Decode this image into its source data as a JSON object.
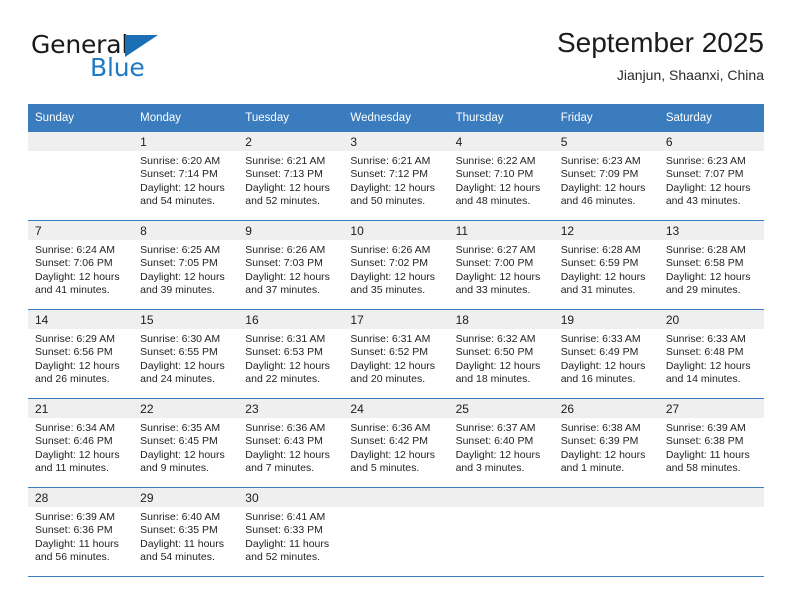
{
  "brand": {
    "name_top": "General",
    "name_bottom": "Blue",
    "accent_color": "#1a6fb5"
  },
  "header": {
    "title": "September 2025",
    "subtitle": "Jianjun, Shaanxi, China"
  },
  "calendar": {
    "header_bg": "#3a7cbe",
    "daynum_bg": "#efefef",
    "weekday_headers": [
      "Sunday",
      "Monday",
      "Tuesday",
      "Wednesday",
      "Thursday",
      "Friday",
      "Saturday"
    ],
    "weeks": [
      [
        {
          "day": "",
          "sunrise": "",
          "sunset": "",
          "daylight_line1": "",
          "daylight_line2": ""
        },
        {
          "day": "1",
          "sunrise": "Sunrise: 6:20 AM",
          "sunset": "Sunset: 7:14 PM",
          "daylight_line1": "Daylight: 12 hours",
          "daylight_line2": "and 54 minutes."
        },
        {
          "day": "2",
          "sunrise": "Sunrise: 6:21 AM",
          "sunset": "Sunset: 7:13 PM",
          "daylight_line1": "Daylight: 12 hours",
          "daylight_line2": "and 52 minutes."
        },
        {
          "day": "3",
          "sunrise": "Sunrise: 6:21 AM",
          "sunset": "Sunset: 7:12 PM",
          "daylight_line1": "Daylight: 12 hours",
          "daylight_line2": "and 50 minutes."
        },
        {
          "day": "4",
          "sunrise": "Sunrise: 6:22 AM",
          "sunset": "Sunset: 7:10 PM",
          "daylight_line1": "Daylight: 12 hours",
          "daylight_line2": "and 48 minutes."
        },
        {
          "day": "5",
          "sunrise": "Sunrise: 6:23 AM",
          "sunset": "Sunset: 7:09 PM",
          "daylight_line1": "Daylight: 12 hours",
          "daylight_line2": "and 46 minutes."
        },
        {
          "day": "6",
          "sunrise": "Sunrise: 6:23 AM",
          "sunset": "Sunset: 7:07 PM",
          "daylight_line1": "Daylight: 12 hours",
          "daylight_line2": "and 43 minutes."
        }
      ],
      [
        {
          "day": "7",
          "sunrise": "Sunrise: 6:24 AM",
          "sunset": "Sunset: 7:06 PM",
          "daylight_line1": "Daylight: 12 hours",
          "daylight_line2": "and 41 minutes."
        },
        {
          "day": "8",
          "sunrise": "Sunrise: 6:25 AM",
          "sunset": "Sunset: 7:05 PM",
          "daylight_line1": "Daylight: 12 hours",
          "daylight_line2": "and 39 minutes."
        },
        {
          "day": "9",
          "sunrise": "Sunrise: 6:26 AM",
          "sunset": "Sunset: 7:03 PM",
          "daylight_line1": "Daylight: 12 hours",
          "daylight_line2": "and 37 minutes."
        },
        {
          "day": "10",
          "sunrise": "Sunrise: 6:26 AM",
          "sunset": "Sunset: 7:02 PM",
          "daylight_line1": "Daylight: 12 hours",
          "daylight_line2": "and 35 minutes."
        },
        {
          "day": "11",
          "sunrise": "Sunrise: 6:27 AM",
          "sunset": "Sunset: 7:00 PM",
          "daylight_line1": "Daylight: 12 hours",
          "daylight_line2": "and 33 minutes."
        },
        {
          "day": "12",
          "sunrise": "Sunrise: 6:28 AM",
          "sunset": "Sunset: 6:59 PM",
          "daylight_line1": "Daylight: 12 hours",
          "daylight_line2": "and 31 minutes."
        },
        {
          "day": "13",
          "sunrise": "Sunrise: 6:28 AM",
          "sunset": "Sunset: 6:58 PM",
          "daylight_line1": "Daylight: 12 hours",
          "daylight_line2": "and 29 minutes."
        }
      ],
      [
        {
          "day": "14",
          "sunrise": "Sunrise: 6:29 AM",
          "sunset": "Sunset: 6:56 PM",
          "daylight_line1": "Daylight: 12 hours",
          "daylight_line2": "and 26 minutes."
        },
        {
          "day": "15",
          "sunrise": "Sunrise: 6:30 AM",
          "sunset": "Sunset: 6:55 PM",
          "daylight_line1": "Daylight: 12 hours",
          "daylight_line2": "and 24 minutes."
        },
        {
          "day": "16",
          "sunrise": "Sunrise: 6:31 AM",
          "sunset": "Sunset: 6:53 PM",
          "daylight_line1": "Daylight: 12 hours",
          "daylight_line2": "and 22 minutes."
        },
        {
          "day": "17",
          "sunrise": "Sunrise: 6:31 AM",
          "sunset": "Sunset: 6:52 PM",
          "daylight_line1": "Daylight: 12 hours",
          "daylight_line2": "and 20 minutes."
        },
        {
          "day": "18",
          "sunrise": "Sunrise: 6:32 AM",
          "sunset": "Sunset: 6:50 PM",
          "daylight_line1": "Daylight: 12 hours",
          "daylight_line2": "and 18 minutes."
        },
        {
          "day": "19",
          "sunrise": "Sunrise: 6:33 AM",
          "sunset": "Sunset: 6:49 PM",
          "daylight_line1": "Daylight: 12 hours",
          "daylight_line2": "and 16 minutes."
        },
        {
          "day": "20",
          "sunrise": "Sunrise: 6:33 AM",
          "sunset": "Sunset: 6:48 PM",
          "daylight_line1": "Daylight: 12 hours",
          "daylight_line2": "and 14 minutes."
        }
      ],
      [
        {
          "day": "21",
          "sunrise": "Sunrise: 6:34 AM",
          "sunset": "Sunset: 6:46 PM",
          "daylight_line1": "Daylight: 12 hours",
          "daylight_line2": "and 11 minutes."
        },
        {
          "day": "22",
          "sunrise": "Sunrise: 6:35 AM",
          "sunset": "Sunset: 6:45 PM",
          "daylight_line1": "Daylight: 12 hours",
          "daylight_line2": "and 9 minutes."
        },
        {
          "day": "23",
          "sunrise": "Sunrise: 6:36 AM",
          "sunset": "Sunset: 6:43 PM",
          "daylight_line1": "Daylight: 12 hours",
          "daylight_line2": "and 7 minutes."
        },
        {
          "day": "24",
          "sunrise": "Sunrise: 6:36 AM",
          "sunset": "Sunset: 6:42 PM",
          "daylight_line1": "Daylight: 12 hours",
          "daylight_line2": "and 5 minutes."
        },
        {
          "day": "25",
          "sunrise": "Sunrise: 6:37 AM",
          "sunset": "Sunset: 6:40 PM",
          "daylight_line1": "Daylight: 12 hours",
          "daylight_line2": "and 3 minutes."
        },
        {
          "day": "26",
          "sunrise": "Sunrise: 6:38 AM",
          "sunset": "Sunset: 6:39 PM",
          "daylight_line1": "Daylight: 12 hours",
          "daylight_line2": "and 1 minute."
        },
        {
          "day": "27",
          "sunrise": "Sunrise: 6:39 AM",
          "sunset": "Sunset: 6:38 PM",
          "daylight_line1": "Daylight: 11 hours",
          "daylight_line2": "and 58 minutes."
        }
      ],
      [
        {
          "day": "28",
          "sunrise": "Sunrise: 6:39 AM",
          "sunset": "Sunset: 6:36 PM",
          "daylight_line1": "Daylight: 11 hours",
          "daylight_line2": "and 56 minutes."
        },
        {
          "day": "29",
          "sunrise": "Sunrise: 6:40 AM",
          "sunset": "Sunset: 6:35 PM",
          "daylight_line1": "Daylight: 11 hours",
          "daylight_line2": "and 54 minutes."
        },
        {
          "day": "30",
          "sunrise": "Sunrise: 6:41 AM",
          "sunset": "Sunset: 6:33 PM",
          "daylight_line1": "Daylight: 11 hours",
          "daylight_line2": "and 52 minutes."
        },
        {
          "day": "",
          "sunrise": "",
          "sunset": "",
          "daylight_line1": "",
          "daylight_line2": ""
        },
        {
          "day": "",
          "sunrise": "",
          "sunset": "",
          "daylight_line1": "",
          "daylight_line2": ""
        },
        {
          "day": "",
          "sunrise": "",
          "sunset": "",
          "daylight_line1": "",
          "daylight_line2": ""
        },
        {
          "day": "",
          "sunrise": "",
          "sunset": "",
          "daylight_line1": "",
          "daylight_line2": ""
        }
      ]
    ]
  }
}
